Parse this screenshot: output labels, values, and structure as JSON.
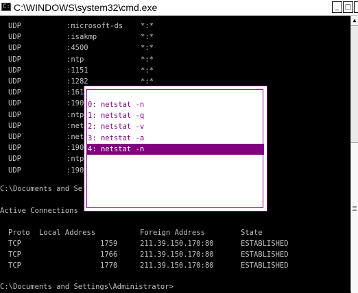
{
  "window": {
    "title": "C:\\WINDOWS\\system32\\cmd.exe",
    "icon_glyph": "C:\\",
    "minimize_glyph": "_",
    "maximize_glyph": "□"
  },
  "udp_rows": [
    {
      "proto": "UDP",
      "local": ":microsoft-ds",
      "foreign": "*:*"
    },
    {
      "proto": "UDP",
      "local": ":isakmp",
      "foreign": "*:*"
    },
    {
      "proto": "UDP",
      "local": ":4500",
      "foreign": "*:*"
    },
    {
      "proto": "UDP",
      "local": ":ntp",
      "foreign": "*:*"
    },
    {
      "proto": "UDP",
      "local": ":1151",
      "foreign": "*:*"
    },
    {
      "proto": "UDP",
      "local": ":1282",
      "foreign": "*:*"
    },
    {
      "proto": "UDP",
      "local": ":161",
      "foreign": ""
    },
    {
      "proto": "UDP",
      "local": ":190",
      "foreign": ""
    },
    {
      "proto": "UDP",
      "local": ":ntp",
      "foreign": ""
    },
    {
      "proto": "UDP",
      "local": ":net",
      "foreign": ""
    },
    {
      "proto": "UDP",
      "local": ":net",
      "foreign": ""
    },
    {
      "proto": "UDP",
      "local": ":190",
      "foreign": ""
    },
    {
      "proto": "UDP",
      "local": ":ntp",
      "foreign": ""
    },
    {
      "proto": "UDP",
      "local": ":190",
      "foreign": ""
    }
  ],
  "prompt_partial": "C:\\Documents and Se",
  "active_connections_label": "Active Connections",
  "tcp_headers": {
    "proto": "Proto",
    "local": "Local Address",
    "foreign": "Foreign Address",
    "state": "State"
  },
  "tcp_rows": [
    {
      "proto": "TCP",
      "local": "1759",
      "foreign": "211.39.150.170:80",
      "state": "ESTABLISHED"
    },
    {
      "proto": "TCP",
      "local": "1766",
      "foreign": "211.39.150.170:80",
      "state": "ESTABLISHED"
    },
    {
      "proto": "TCP",
      "local": "1770",
      "foreign": "211.39.150.170:80",
      "state": "ESTABLISHED"
    }
  ],
  "prompt_final": "C:\\Documents and Settings\\Administrator>",
  "history": {
    "items": [
      "0: netstat -n",
      "1: netstat -q",
      "2: netstat -v",
      "3: netstat -a",
      "4: netstat -n"
    ],
    "selected_index": 4
  },
  "colors": {
    "console_bg": "#000000",
    "console_text": "#c0c0c0",
    "popup_accent": "#800080"
  },
  "scrollbar": {
    "up_arrow": "▲"
  }
}
